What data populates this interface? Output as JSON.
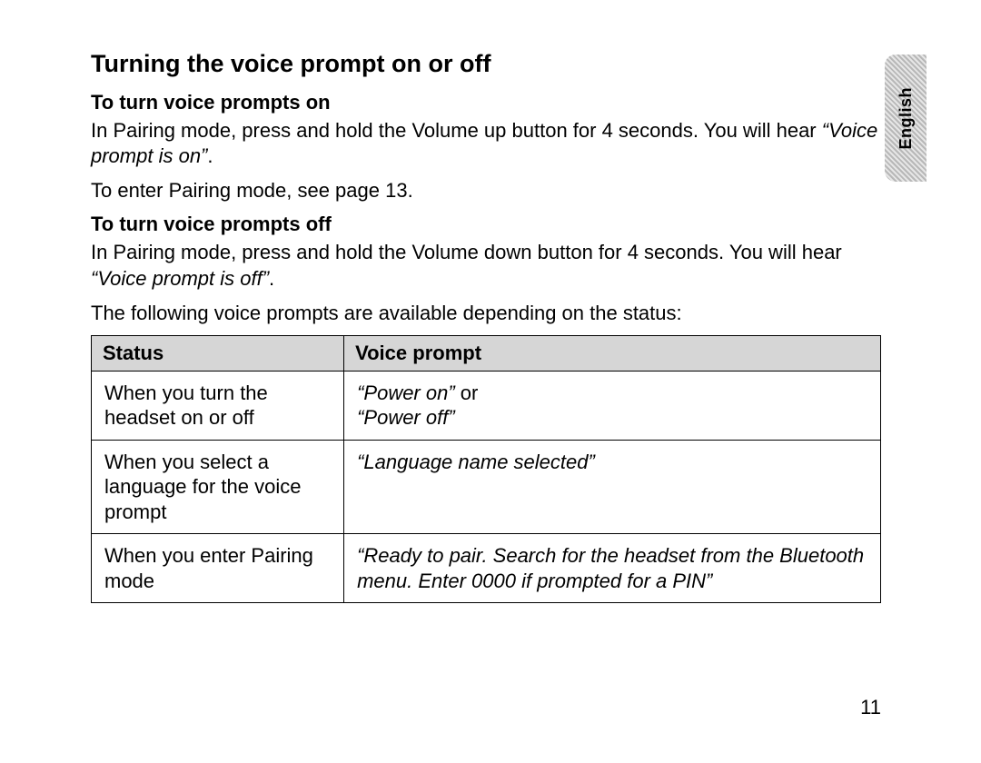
{
  "title": "Turning the voice prompt on or off",
  "language_tab": "English",
  "section_on": {
    "heading": "To turn voice prompts on",
    "para1_a": "In Pairing mode, press and hold the Volume up button for 4 seconds. You will hear ",
    "para1_quote": "“Voice prompt is on”",
    "para1_b": ".",
    "para2": "To enter Pairing mode, see page 13."
  },
  "section_off": {
    "heading": "To turn voice prompts off",
    "para1_a": "In Pairing mode, press and hold the Volume down button for 4 seconds. You will hear ",
    "para1_quote": "“Voice prompt is off”",
    "para1_b": ".",
    "para2": "The following voice prompts are available depending on the status:"
  },
  "table": {
    "headers": {
      "status": "Status",
      "prompt": "Voice prompt"
    },
    "rows": [
      {
        "status": "When you turn the headset on or off",
        "prompt_a": "“Power on”",
        "prompt_mid": " or",
        "prompt_b": "“Power off”"
      },
      {
        "status": "When you select a language for the voice prompt",
        "prompt_a": "“Language name selected”",
        "prompt_mid": "",
        "prompt_b": ""
      },
      {
        "status": "When you enter Pairing mode",
        "prompt_a": "“Ready to pair. Search for the headset from the Bluetooth menu. Enter 0000 if prompted for a PIN”",
        "prompt_mid": "",
        "prompt_b": ""
      }
    ]
  },
  "page_number": "11"
}
